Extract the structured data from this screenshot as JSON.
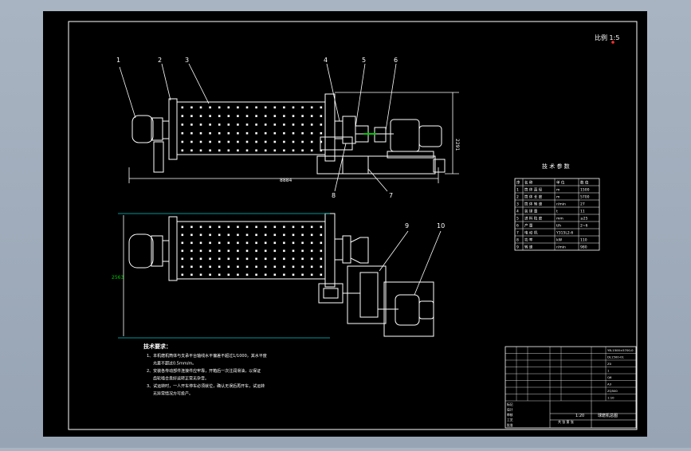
{
  "drawing": {
    "scale_note": "比例 1:5",
    "part_numbers": [
      "1",
      "2",
      "3",
      "4",
      "5",
      "6",
      "7",
      "8",
      "9",
      "10"
    ],
    "dim_length": "8884",
    "dim_height": "2291",
    "dim_width": "2563",
    "colors": {
      "background": "#000000",
      "frame": "#ffffff",
      "dimension_line": "#00c8c8",
      "dimension_text": "#00c800",
      "accent": "#ff3030"
    }
  },
  "tech_params": {
    "title": "技 术 参 数",
    "headers": [
      "序",
      "名 称",
      "单 位",
      "数 值"
    ],
    "rows": [
      [
        "1",
        "筒 体 直 径",
        "m",
        "1500"
      ],
      [
        "2",
        "筒 体 长 度",
        "m",
        "5700"
      ],
      [
        "3",
        "筒 体 转 速",
        "r/min",
        "27"
      ],
      [
        "4",
        "装 球 量",
        "t",
        "11"
      ],
      [
        "5",
        "进 料 粒 度",
        "mm",
        "≤25"
      ],
      [
        "6",
        "产 量",
        "t/h",
        "2~6"
      ],
      [
        "7",
        "电 动 机",
        "Y315L2-6",
        ""
      ],
      [
        "8",
        "功 率",
        "kW",
        "110"
      ],
      [
        "9",
        "转 速",
        "r/min",
        "980"
      ]
    ]
  },
  "tech_requirements": {
    "title": "技术要求：",
    "items": [
      "1、本机磨机筒体与支承平台轴线水平偏差不超过1/1000，其水平度",
      "允差不超过0.5mm/m。",
      "2、安装各传动部件连接件应牢靠，开箱后一次注润滑油，以保证",
      "齿轮啮合良好运转正常无杂音。",
      "3、试运转时，一人开车停车必须就位，确认无误后再开车，试运转",
      "无异常情况方可投产。"
    ]
  },
  "title_block": {
    "drawing_name": "球磨机总图",
    "scale": "1:20",
    "sheet": "共 张 第 张",
    "rows": [
      [
        "",
        "",
        "",
        "",
        "YB-1500×5700-0"
      ],
      [
        "",
        "",
        "",
        "",
        "DL1500-01"
      ],
      [
        "",
        "",
        "",
        "",
        "Z0"
      ],
      [
        "",
        "",
        "",
        "",
        "1"
      ],
      [
        "",
        "",
        "",
        "",
        "Q6"
      ],
      [
        "",
        "",
        "",
        "",
        "A3"
      ],
      [
        "",
        "",
        "",
        "",
        "ZQ500"
      ],
      [
        "",
        "",
        "",
        "",
        "1:10"
      ]
    ],
    "labels": [
      "标记",
      "设计",
      "审核",
      "工艺",
      "批准"
    ]
  }
}
